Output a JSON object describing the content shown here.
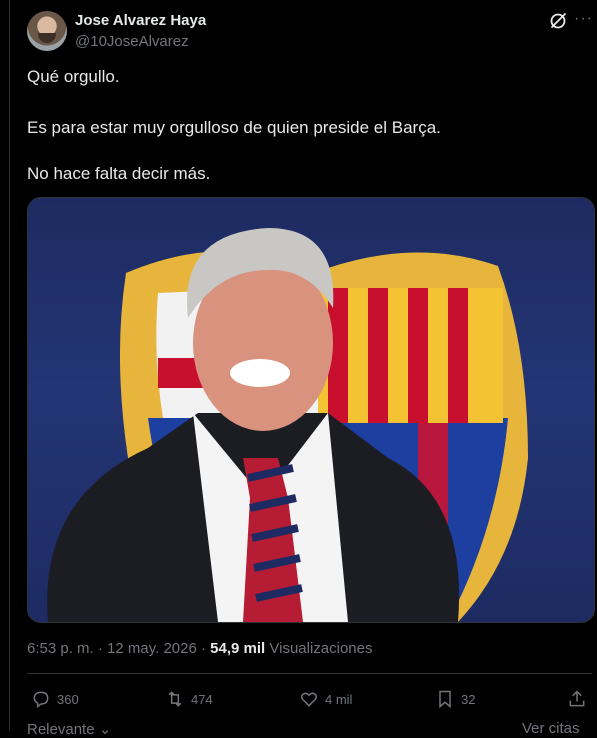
{
  "author": {
    "name": "Jose Alvarez Haya",
    "handle": "@10JoseAlvarez",
    "avatar_icon": "profile-photo"
  },
  "post": {
    "lines": [
      "Qué orgullo.",
      "Es para estar muy orgulloso de quien preside el Barça.",
      "No hace falta decir más."
    ],
    "media_alt_icon": "photo-man-in-suit-barca-crest"
  },
  "meta": {
    "time_date": "6:53 p. m. · 12 may. 2026 · ",
    "views_count": "54,9 mil",
    "views_label": "Visualizaciones"
  },
  "actions": {
    "replies": "360",
    "reposts": "474",
    "likes": "4 mil",
    "bookmarks": "32"
  },
  "footer": {
    "sort_label": "Relevante",
    "quotes_label": "Ver citas"
  },
  "colors": {
    "background": "#000000",
    "text_primary": "#e7e9ea",
    "text_secondary": "#71767b",
    "border": "#2f3336"
  }
}
